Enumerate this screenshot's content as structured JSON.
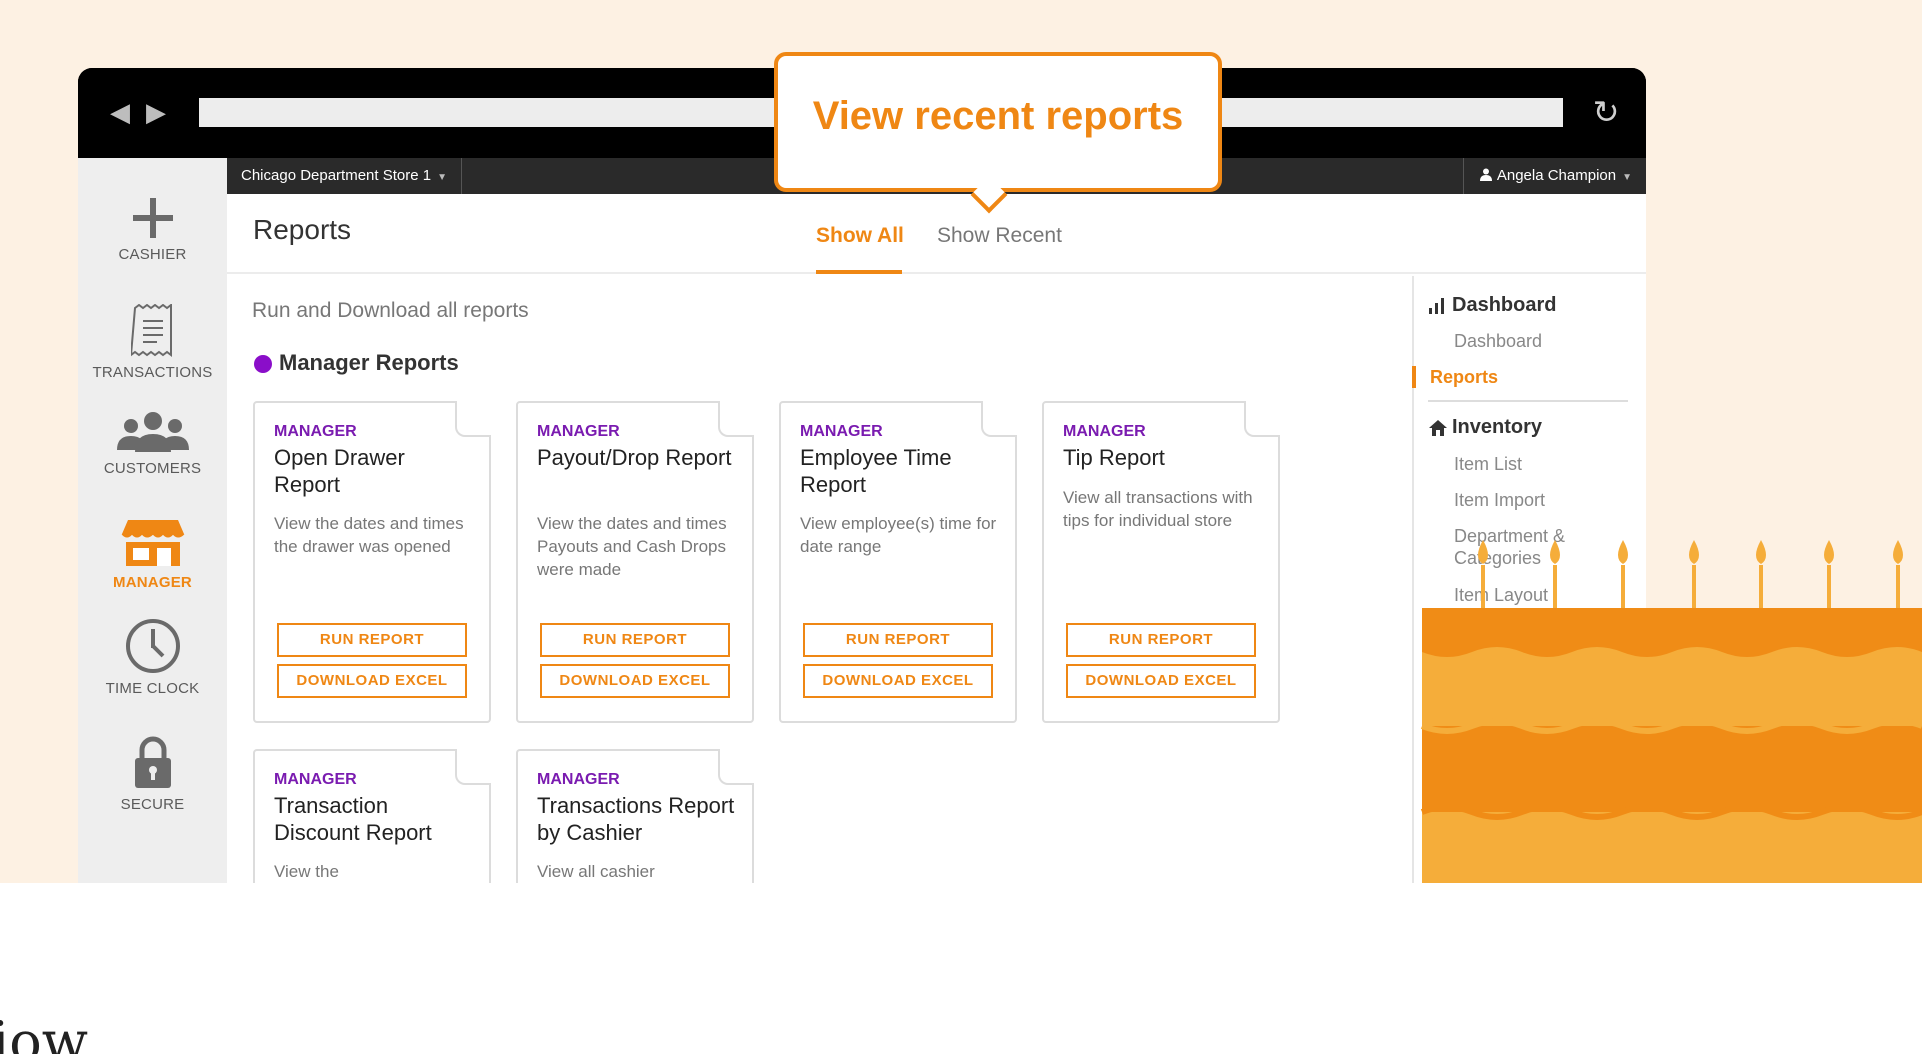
{
  "browser": {
    "back_label": "◀",
    "forward_label": "▶",
    "reload_label": "↻"
  },
  "tooltip": {
    "text": "View recent reports"
  },
  "left_nav": {
    "items": [
      {
        "label": "CASHIER",
        "icon": "plus-icon"
      },
      {
        "label": "TRANSACTIONS",
        "icon": "receipt-icon"
      },
      {
        "label": "CUSTOMERS",
        "icon": "users-icon"
      },
      {
        "label": "MANAGER",
        "icon": "store-icon",
        "active": true
      },
      {
        "label": "TIME CLOCK",
        "icon": "clock-icon"
      },
      {
        "label": "SECURE",
        "icon": "lock-icon"
      }
    ]
  },
  "topbar": {
    "store": "Chicago Department Store 1",
    "user": "Angela Champion"
  },
  "header": {
    "title": "Reports",
    "tabs": [
      {
        "label": "Show All",
        "active": true
      },
      {
        "label": "Show Recent",
        "active": false
      }
    ]
  },
  "content": {
    "subtitle": "Run and Download all reports",
    "section_title": "Manager Reports",
    "cards": [
      {
        "category": "MANAGER",
        "title": "Open Drawer Report",
        "desc": "View the dates and times the drawer was opened",
        "run": "RUN REPORT",
        "download": "DOWNLOAD EXCEL"
      },
      {
        "category": "MANAGER",
        "title": "Payout/Drop Report",
        "desc": "View the dates and times Payouts and Cash Drops were made",
        "run": "RUN REPORT",
        "download": "DOWNLOAD EXCEL"
      },
      {
        "category": "MANAGER",
        "title": "Employee Time Report",
        "desc": "View employee(s) time for date range",
        "run": "RUN REPORT",
        "download": "DOWNLOAD EXCEL"
      },
      {
        "category": "MANAGER",
        "title": "Tip Report",
        "desc": "View all transactions with tips for individual store",
        "run": "RUN REPORT",
        "download": "DOWNLOAD EXCEL"
      },
      {
        "category": "MANAGER",
        "title": "Transaction Discount Report",
        "desc": "View the"
      },
      {
        "category": "MANAGER",
        "title": "Transactions Report by Cashier",
        "desc": "View all cashier"
      }
    ]
  },
  "right_panel": {
    "dashboard_head": "Dashboard",
    "dashboard_items": [
      "Dashboard",
      "Reports"
    ],
    "inventory_head": "Inventory",
    "inventory_items": [
      "Item List",
      "Item Import",
      "Department & Categories",
      "Item Layout"
    ]
  },
  "bottom_text": "iow",
  "colors": {
    "accent": "#ef8714",
    "purple": "#8a0ec9",
    "background": "#fdf1e3",
    "cake_dark": "#f08c16",
    "cake_light": "#f5ad3a"
  }
}
